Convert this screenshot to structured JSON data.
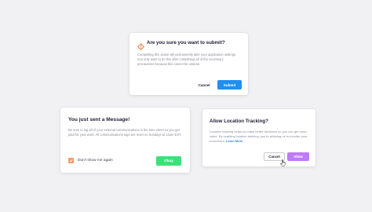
{
  "submit_dialog": {
    "title": "Are you sure you want to submit?",
    "body": "Completing this action will permanently alter your application settings. You only want to do this after completing all of the necessary precautions because this cannot be undone.",
    "cancel_label": "Cancel",
    "submit_label": "Submit",
    "icon": "warning-diamond-icon",
    "icon_color": "#f28b54",
    "submit_color": "#1f8ff2"
  },
  "message_dialog": {
    "title": "You just sent a Message!",
    "body": "Be sure to log all of your external communications in the time sheet so you get paid for your work. All communications logs are reset on Sundays at 12am EST.",
    "checkbox_label": "Don't show me again",
    "checkbox_checked": true,
    "checkbox_color": "#f29a6b",
    "okay_label": "Okay",
    "okay_color": "#3fe07a"
  },
  "location_dialog": {
    "title": "Allow Location Tracking?",
    "body": "Location tracking helps us make better decisions so you can get more value. By enabling location tracking, you're allowing us to monitor your movement.",
    "learn_more_label": "Learn More",
    "cancel_label": "Cancel",
    "allow_label": "Allow",
    "allow_color": "#bd7cf2"
  }
}
